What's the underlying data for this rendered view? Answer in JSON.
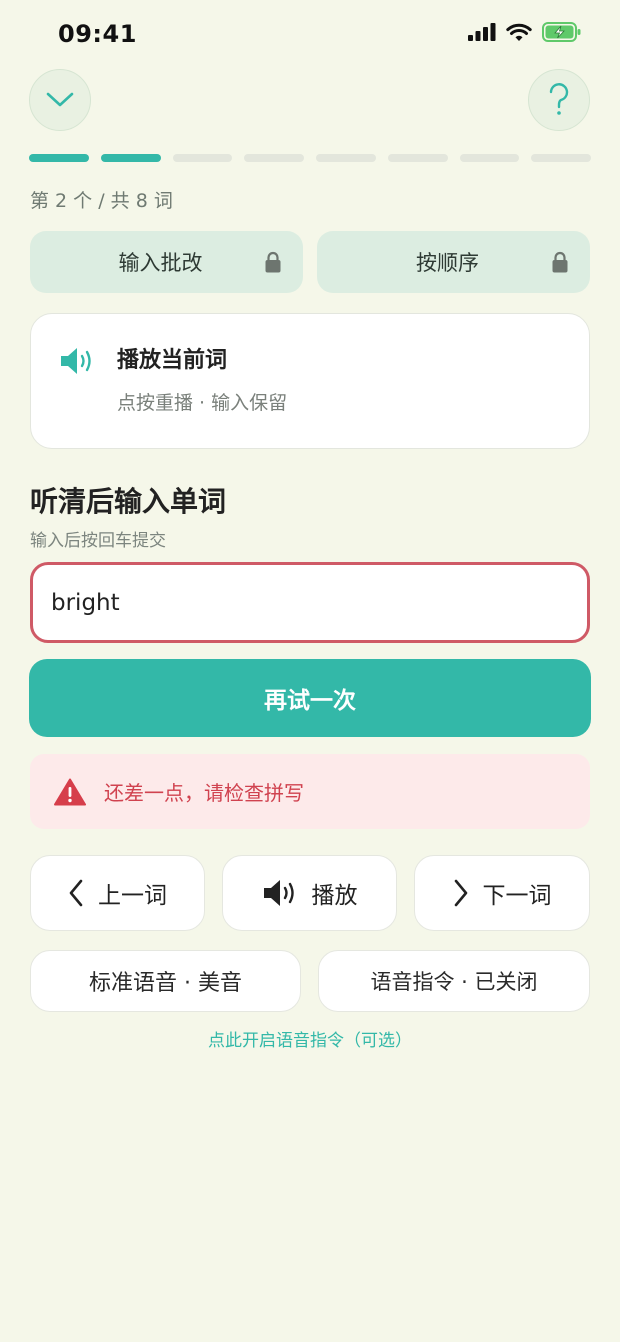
{
  "status_bar": {
    "time": "09:41"
  },
  "header": {
    "collapse_icon": "chevron-down-icon",
    "help_icon": "question-icon"
  },
  "progress": {
    "current": 2,
    "total": 8,
    "label": "第 2 个 / 共 8 词",
    "colors": {
      "active": "#33b8a8",
      "inactive": "#e3e6dc"
    }
  },
  "modes": [
    {
      "label": "输入批改",
      "locked": true
    },
    {
      "label": "按顺序",
      "locked": true
    }
  ],
  "play_card": {
    "title": "播放当前词",
    "subtitle": "点按重播 · 输入保留"
  },
  "prompt": {
    "title": "听清后输入单词",
    "hint": "输入后按回车提交"
  },
  "answer_input": {
    "value": "bright"
  },
  "retry_button": {
    "label": "再试一次"
  },
  "feedback": {
    "message": "还差一点，请检查拼写",
    "color": "#d0424f"
  },
  "nav": {
    "prev_label": "上一词",
    "play_label": "播放",
    "next_label": "下一词"
  },
  "settings": {
    "voice_label": "标准语音 · 美音",
    "command_label": "语音指令 · 已关闭",
    "enable_link": "点此开启语音指令（可选）"
  },
  "theme": {
    "accent": "#33b8a8",
    "background": "#f5f7e9",
    "error": "#cf5a66"
  }
}
